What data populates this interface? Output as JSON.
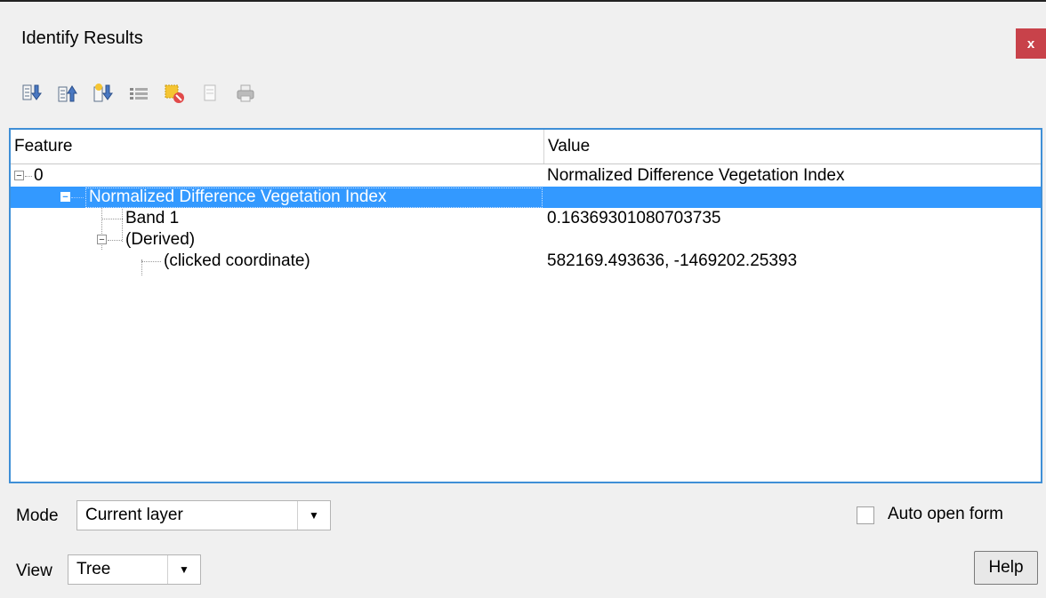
{
  "window": {
    "title": "Identify Results",
    "close_label": "x"
  },
  "toolbar": {
    "items": [
      {
        "icon": "expand-all-icon"
      },
      {
        "icon": "collapse-all-icon"
      },
      {
        "icon": "expand-new-results-icon"
      },
      {
        "icon": "open-form-icon"
      },
      {
        "icon": "clear-results-icon"
      },
      {
        "icon": "copy-feature-icon"
      },
      {
        "icon": "print-icon"
      }
    ]
  },
  "tree": {
    "columns": {
      "feature": "Feature",
      "value": "Value"
    },
    "rows": [
      {
        "feature": "0",
        "value": "Normalized Difference Vegetation Index"
      },
      {
        "feature": "Normalized Difference Vegetation Index",
        "value": ""
      },
      {
        "feature": "Band 1",
        "value": "0.16369301080703735"
      },
      {
        "feature": "(Derived)",
        "value": ""
      },
      {
        "feature": "(clicked coordinate)",
        "value": "582169.493636, -1469202.25393"
      }
    ]
  },
  "footer": {
    "mode_label": "Mode",
    "mode_value": "Current layer",
    "view_label": "View",
    "view_value": "Tree",
    "auto_open_form_label": "Auto open form",
    "auto_open_form_checked": false,
    "help_label": "Help"
  }
}
